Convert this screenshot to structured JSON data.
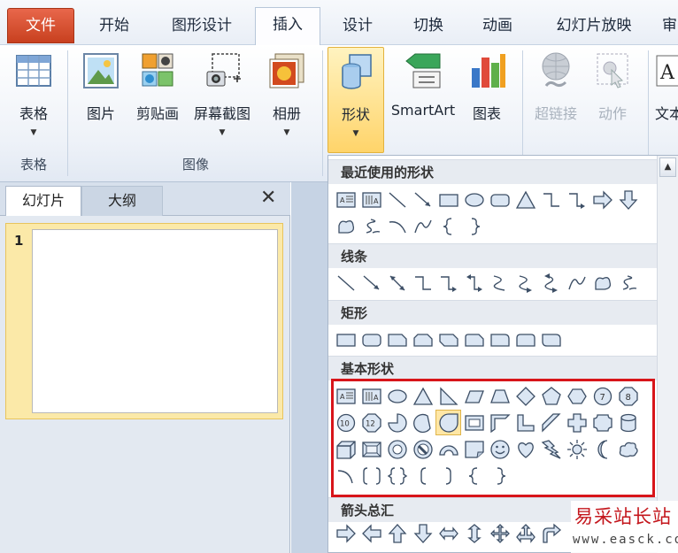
{
  "tabs": {
    "file": "文件",
    "home": "开始",
    "design_shape": "图形设计",
    "insert": "插入",
    "design": "设计",
    "transitions": "切换",
    "animations": "动画",
    "slideshow": "幻灯片放映",
    "review_partial": "审"
  },
  "ribbon": {
    "table": "表格",
    "picture": "图片",
    "clipart": "剪贴画",
    "screenshot": "屏幕截图",
    "album": "相册",
    "shapes": "形状",
    "smartart": "SmartArt",
    "chart": "图表",
    "hyperlink": "超链接",
    "action": "动作",
    "textbox_partial": "文本",
    "group_table": "表格",
    "group_images": "图像"
  },
  "left_pane": {
    "tab_slides": "幻灯片",
    "tab_outline": "大纲",
    "close": "✕",
    "slide_number": "1"
  },
  "shape_panel": {
    "recent": "最近使用的形状",
    "lines": "线条",
    "rectangles": "矩形",
    "basic": "基本形状",
    "arrows": "箭头总汇"
  },
  "highlight_color": "#d8151a",
  "watermark": {
    "main": "易采站长站",
    "url": "www.easck.com"
  }
}
